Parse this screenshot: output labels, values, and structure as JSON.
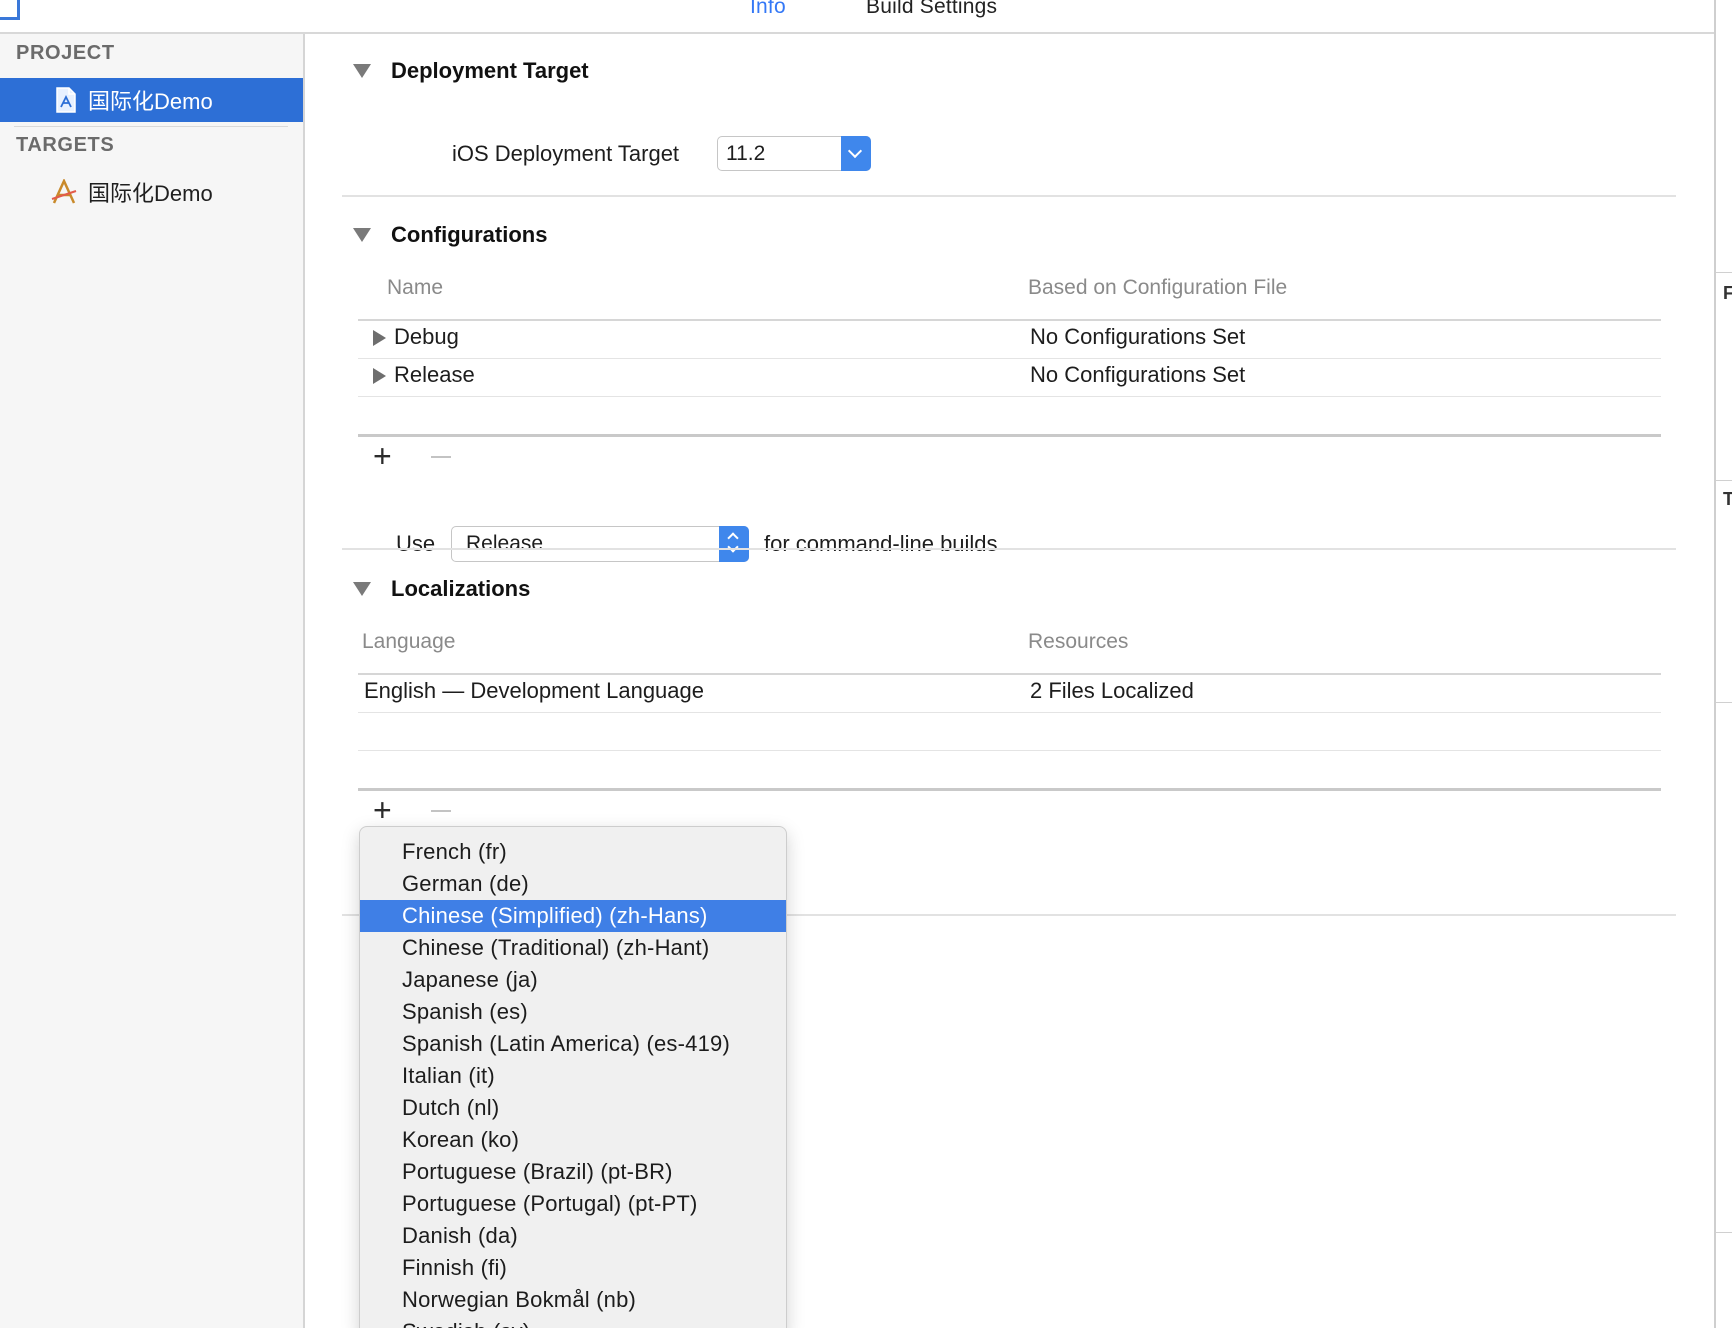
{
  "tabs": [
    {
      "label": "Info",
      "active": true
    },
    {
      "label": "Build Settings",
      "active": false
    }
  ],
  "sidebar": {
    "project_header": "PROJECT",
    "project_item": {
      "label": "国际化Demo",
      "icon": "project-file-icon",
      "selected": true
    },
    "targets_header": "TARGETS",
    "target_item": {
      "label": "国际化Demo",
      "icon": "app-target-icon"
    }
  },
  "deployment": {
    "title": "Deployment Target",
    "ios_label": "iOS Deployment Target",
    "ios_value": "11.2"
  },
  "configurations": {
    "title": "Configurations",
    "col_name": "Name",
    "col_file": "Based on Configuration File",
    "rows": [
      {
        "name": "Debug",
        "file": "No Configurations Set"
      },
      {
        "name": "Release",
        "file": "No Configurations Set"
      }
    ],
    "use_label": "Use",
    "use_value": "Release",
    "use_suffix": "for command-line builds"
  },
  "localizations": {
    "title": "Localizations",
    "col_language": "Language",
    "col_resources": "Resources",
    "rows": [
      {
        "language": "English — Development Language",
        "resources": "2 Files Localized"
      }
    ]
  },
  "add_symbol": "+",
  "language_menu": {
    "highlighted_index": 2,
    "items": [
      "French (fr)",
      "German (de)",
      "Chinese (Simplified) (zh-Hans)",
      "Chinese (Traditional) (zh-Hant)",
      "Japanese (ja)",
      "Spanish (es)",
      "Spanish (Latin America) (es-419)",
      "Italian (it)",
      "Dutch (nl)",
      "Korean (ko)",
      "Portuguese (Brazil) (pt-BR)",
      "Portuguese (Portugal) (pt-PT)",
      "Danish (da)",
      "Finnish (fi)",
      "Norwegian Bokmål (nb)",
      "Swedish (sv)"
    ]
  },
  "colors": {
    "accent": "#3478f6",
    "selection": "#2d6fd6",
    "menu_highlight": "#3f7fe6"
  }
}
